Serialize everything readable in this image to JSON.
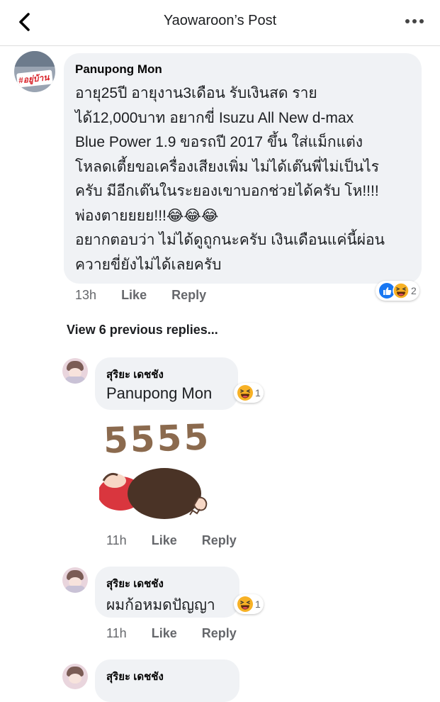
{
  "header": {
    "title": "Yaowaroon’s Post",
    "back_icon": "chevron-left-icon",
    "more_icon": "ellipsis-icon"
  },
  "main_comment": {
    "author": "Panupong Mon",
    "avatar_text": "#อยู่บ้าน",
    "lines": [
      "อายุ25ปี อายุงาน3เดือน  รับเงินสด ราย",
      "ได้12,000บาท อยากขี่ Isuzu All New d-max",
      "Blue Power 1.9 ขอรถปี 2017 ขึ้น ใส่แม็กแต่ง",
      "โหลดเตี้ยขอเครื่องเสียงเพิ่ม ไม่ได้เต๊นพี่ไม่เป็นไร",
      "ครับ มีอีกเต๊นในระยองเขาบอกช่วยได้ครับ โห!!!!",
      "พ่องตายยยย!!!😂😂😂",
      "อยากตอบว่า ไม่ได้ดูถูกนะครับ เงินเดือนแค่นี้ผ่อน",
      "ควายขี่ยังไม่ได้เลยครับ"
    ],
    "time": "13h",
    "like": "Like",
    "reply": "Reply",
    "reaction_count": "2"
  },
  "view_previous": "View 6 previous replies...",
  "replies": [
    {
      "author": "สุริยะ เดชชัง",
      "text": "Panupong Mon",
      "time": "11h",
      "like": "Like",
      "reply": "Reply",
      "reaction_count": "1",
      "sticker_text": "5555"
    },
    {
      "author": "สุริยะ เดชชัง",
      "text": "ผมก้อหมดปัญญา",
      "time": "11h",
      "like": "Like",
      "reply": "Reply",
      "reaction_count": "1"
    },
    {
      "author": "สุริยะ เดชชัง"
    }
  ],
  "colors": {
    "bubble": "#f0f2f5",
    "meta": "#65676b",
    "like_blue": "#1877f2",
    "haha_yellow": "#f7b125"
  }
}
